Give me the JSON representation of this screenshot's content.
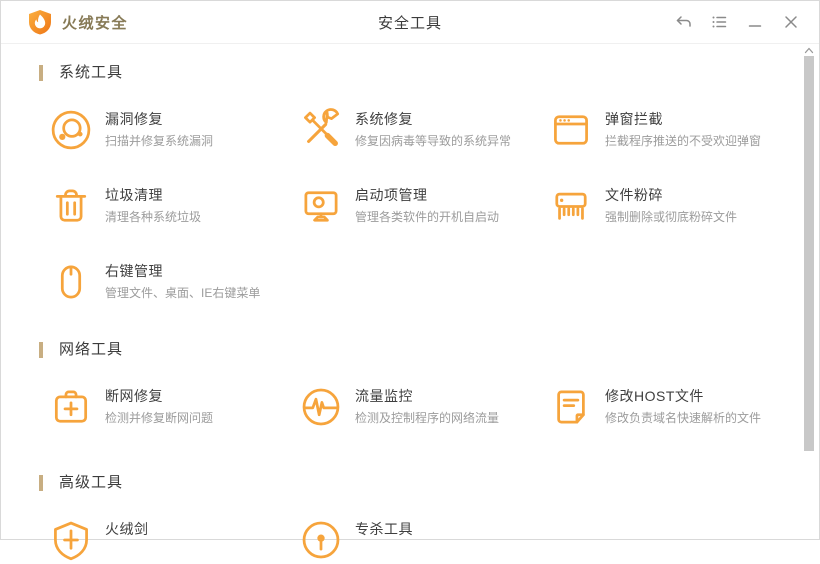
{
  "titlebar": {
    "app_name": "火绒安全",
    "page_title": "安全工具",
    "controls": [
      "back-icon",
      "menu-icon",
      "minimize-icon",
      "close-icon"
    ]
  },
  "sections": [
    {
      "name": "系统工具",
      "items": [
        {
          "icon": "vulnerability-fix-icon",
          "title": "漏洞修复",
          "desc": "扫描并修复系统漏洞"
        },
        {
          "icon": "system-repair-icon",
          "title": "系统修复",
          "desc": "修复因病毒等导致的系统异常"
        },
        {
          "icon": "popup-blocker-icon",
          "title": "弹窗拦截",
          "desc": "拦截程序推送的不受欢迎弹窗"
        },
        {
          "icon": "junk-clean-icon",
          "title": "垃圾清理",
          "desc": "清理各种系统垃圾"
        },
        {
          "icon": "startup-manager-icon",
          "title": "启动项管理",
          "desc": "管理各类软件的开机自启动"
        },
        {
          "icon": "file-shredder-icon",
          "title": "文件粉碎",
          "desc": "强制删除或彻底粉碎文件"
        },
        {
          "icon": "right-click-manager-icon",
          "title": "右键管理",
          "desc": "管理文件、桌面、IE右键菜单"
        }
      ]
    },
    {
      "name": "网络工具",
      "items": [
        {
          "icon": "network-repair-icon",
          "title": "断网修复",
          "desc": "检测并修复断网问题"
        },
        {
          "icon": "traffic-monitor-icon",
          "title": "流量监控",
          "desc": "检测及控制程序的网络流量"
        },
        {
          "icon": "host-file-icon",
          "title": "修改HOST文件",
          "desc": "修改负责域名快速解析的文件"
        }
      ]
    },
    {
      "name": "高级工具",
      "items": [
        {
          "icon": "huorong-sword-icon",
          "title": "火绒剑"
        },
        {
          "icon": "special-kill-icon",
          "title": "专杀工具"
        }
      ]
    }
  ],
  "colors": {
    "accent": "#F6A43C",
    "section_bar": "#C8AE82",
    "logo_text": "#877A56",
    "title_text": "#3F3F3F",
    "desc_text": "#9C9C9C"
  }
}
